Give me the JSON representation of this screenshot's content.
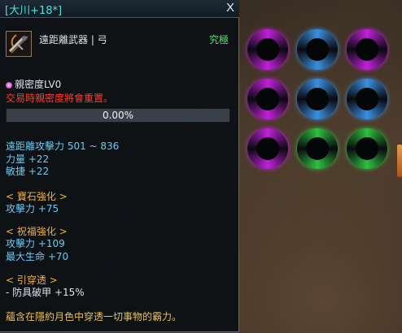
{
  "title": "[大川+18*]",
  "close_label": "X",
  "item": {
    "type": "遠距離武器 | 弓",
    "rank": "究極",
    "icon": "bow-icon"
  },
  "affinity": {
    "label": "親密度LV0",
    "warning": "交易時親密度將會重置。",
    "progress_text": "0.00%",
    "progress_value": 0
  },
  "base_stats": {
    "attack": "遠距離攻擊力 501 ~ 836",
    "strength": "力量 +22",
    "agility": "敏捷 +22"
  },
  "gem_section": {
    "header": "< 寶石強化 >",
    "line1": "攻擊力 +75"
  },
  "blessing_section": {
    "header": "< 祝福強化 >",
    "line1": "攻擊力 +109",
    "line2": "最大生命 +70"
  },
  "pierce_section": {
    "header": "< 引穿透 >",
    "line1": "- 防具破甲 +15%"
  },
  "description": "蘊含在隱約月色中穿透一切事物的霸力。",
  "slots": {
    "colors": {
      "purple": "#c020d8",
      "blue": "#3a8fe0",
      "green": "#2ec040"
    },
    "grid": [
      [
        "purple",
        "blue",
        "purple"
      ],
      [
        "purple",
        "blue",
        "blue"
      ],
      [
        "purple",
        "green",
        "green"
      ]
    ]
  }
}
